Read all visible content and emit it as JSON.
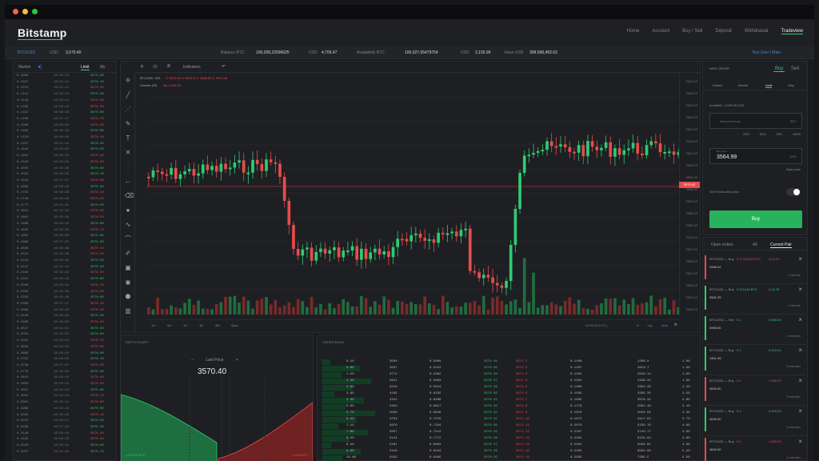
{
  "window": {
    "dots": [
      "#ff5f56",
      "#ffbd2e",
      "#27c93f"
    ]
  },
  "brand": {
    "name": "Bitstamp"
  },
  "nav": {
    "links": [
      "Home",
      "Account",
      "Buy / Sell",
      "Deposit",
      "Withdrawal",
      "Tradeview"
    ],
    "active": "Tradeview"
  },
  "infobar": {
    "pair": "BTC/USD",
    "usd_label": "USD",
    "usd_value": "3,570.40",
    "balance_label": "Balance BTC",
    "balance_value": "100,028,22596625",
    "usd2_label": "USD",
    "usd2_value": "4,705.47",
    "availability_label": "Availability BTC",
    "availability_value": "100,027,05479754",
    "usd3_label": "USD",
    "usd3_value": "3,155.99",
    "value_label": "Value USD",
    "value_value": "358,598,493.63",
    "user": "Test User / Main"
  },
  "trades": {
    "tabs": [
      "Market",
      "Limit",
      "My"
    ],
    "active": "Limit"
  },
  "chart": {
    "symbol": "BTCUSD, 900",
    "ohlc": "O 3575.00 H 3576.00 L 3568.00 C 3570.40",
    "volume": "Volume (20)",
    "volume_val": "n/a 1,416.26",
    "indicators": "Indicators",
    "timeframes": [
      "1m",
      "5m",
      "1H",
      "1D",
      "3M",
      "Sync"
    ],
    "current_price": "3570.40",
    "time_label": "18:08:28 (UTC)"
  },
  "depth": {
    "title": "DEPTH CHART",
    "last_price_label": "Last Price",
    "last_price": "3570.40",
    "left_label": "4,571.99 BTC",
    "right_label": "4,649 BTC"
  },
  "orderbook": {
    "title": "ORDER BOOK"
  },
  "order_form": {
    "title": "NEW ORDER",
    "buy": "Buy",
    "sell": "Sell",
    "types": [
      "Instant",
      "Market",
      "Limit",
      "Stop"
    ],
    "active_type": "Limit",
    "available": "Available: 3,155.99 USD",
    "amount_placeholder": "Amount to buy",
    "amount_unit": "BTC",
    "pcts": [
      "25%",
      "50%",
      "75%",
      "100%"
    ],
    "price_label": "Buy price",
    "price_value": "3564.99",
    "price_unit": "USD",
    "spot_price": "Spot price",
    "hide_label": "Sell if executed price",
    "buy_button": "Buy"
  },
  "orders_tabs": {
    "tabs": [
      "Open orders",
      "All",
      "Current Pair"
    ],
    "active": "Current Pair"
  },
  "notifications": [
    {
      "title": "BTC/USD — Buy",
      "amount": "0.17120152 BTC",
      "price": "4,14.25",
      "total": "2596.04",
      "age": "1 minute",
      "color": "#e74c4c"
    },
    {
      "title": "BTC/USD — Buy",
      "amount": "0.121445 BTC",
      "price": "4,24.76",
      "total": "3561.25",
      "age": "1 minute",
      "color": "#2ecc71"
    },
    {
      "title": "BTC/USD — Sell",
      "amount": "0.1",
      "price": "3,965.00",
      "total": "3965.00",
      "age": "4 minutes",
      "color": "#2ecc71"
    },
    {
      "title": "BTC/USD — Buy",
      "amount": "0.1",
      "price": "4,010.00",
      "total": "1901.28",
      "age": "5 minutes",
      "color": "#2ecc71"
    },
    {
      "title": "BTC/USD — Buy",
      "amount": "0.4",
      "price": "1,698.00",
      "total": "4630.00",
      "age": "5 minutes",
      "color": "#e74c4c"
    },
    {
      "title": "BTC/USD — Buy",
      "amount": "0.2",
      "price": "4,010.00",
      "total": "4630.00",
      "age": "6 minutes",
      "color": "#2ecc71"
    },
    {
      "title": "BTC/USD — Buy",
      "amount": "0.4",
      "price": "1,600.00",
      "total": "4630.00",
      "age": "6 minutes",
      "color": "#e74c4c"
    }
  ],
  "colors": {
    "green": "#2ecc71",
    "red": "#e74c4c",
    "accent": "#27b35b"
  }
}
